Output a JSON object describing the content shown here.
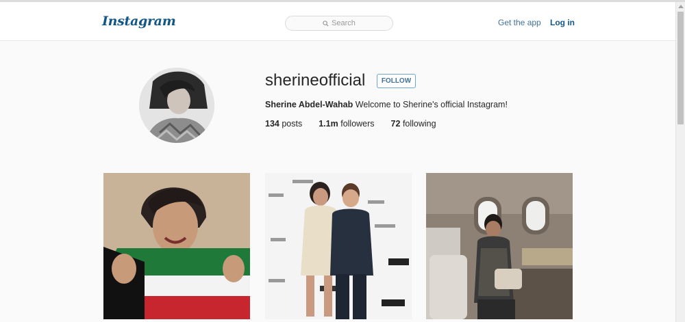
{
  "header": {
    "logo": "Instagram",
    "search_placeholder": "Search",
    "get_app": "Get the app",
    "login": "Log in"
  },
  "profile": {
    "username": "sherineofficial",
    "follow_label": "FOLLOW",
    "full_name": "Sherine Abdel-Wahab",
    "bio": "Welcome to Sherine's official Instagram!",
    "stats": {
      "posts_count": "134",
      "posts_label": "posts",
      "followers_count": "1.1m",
      "followers_label": "followers",
      "following_count": "72",
      "following_label": "following"
    }
  },
  "posts": [
    {
      "description": "portrait with Kuwait flag"
    },
    {
      "description": "press wall photo with man in suit"
    },
    {
      "description": "woman seated on airplane"
    }
  ],
  "colors": {
    "brand": "#125688",
    "link": "#3f729b",
    "background": "#fafafa"
  }
}
